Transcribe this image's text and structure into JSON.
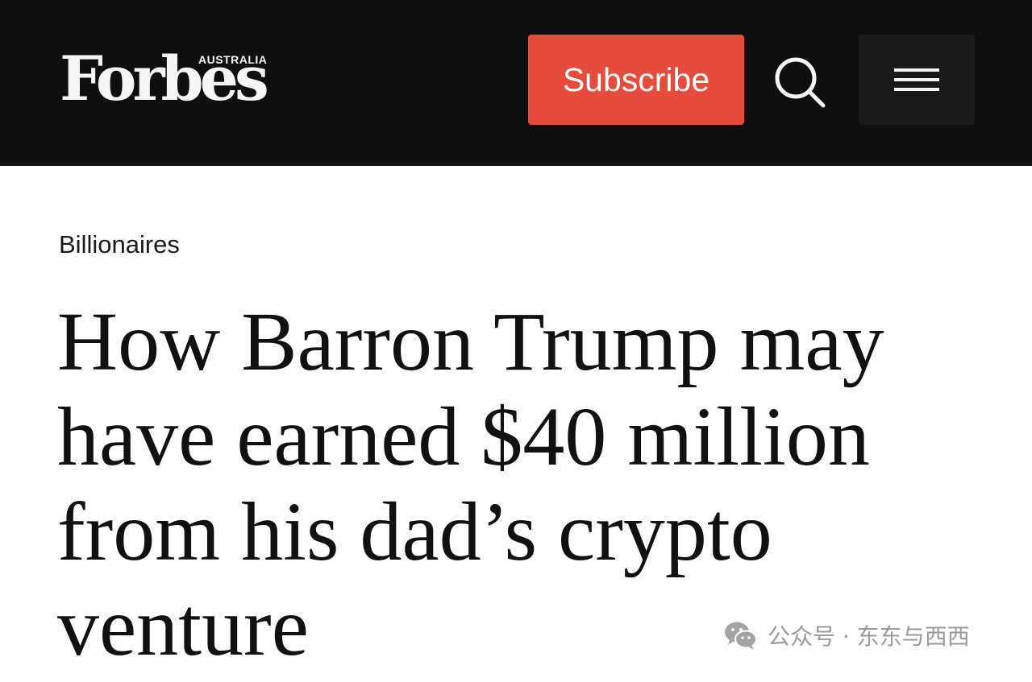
{
  "header": {
    "logo_text": "Forbes",
    "logo_sub": "AUSTRALIA",
    "subscribe_label": "Subscribe",
    "search_icon": "search-icon",
    "menu_icon": "hamburger-menu-icon"
  },
  "article": {
    "category": "Billionaires",
    "headline": "How Barron Trump may have earned $40 million from his dad’s crypto venture"
  },
  "watermark": {
    "icon": "wechat-icon",
    "text": "公众号 · 东东与西西"
  },
  "colors": {
    "header_bg": "#0f0f0f",
    "subscribe_bg": "#e64b3c",
    "menu_bg": "#1a1a1a",
    "text": "#111111"
  }
}
